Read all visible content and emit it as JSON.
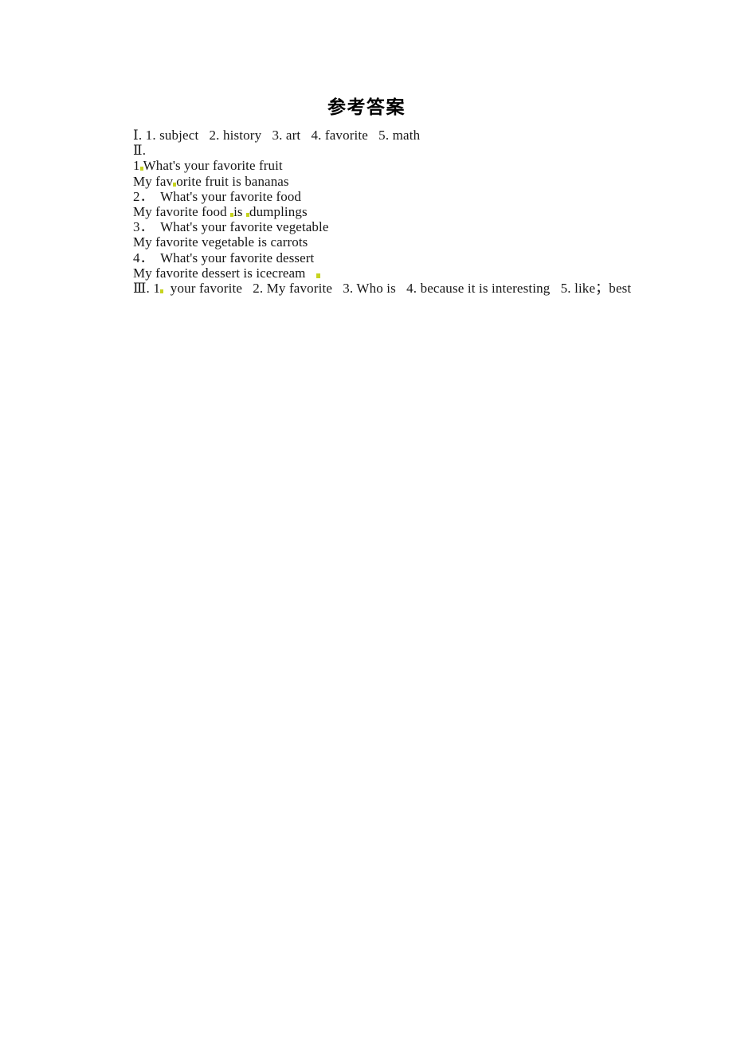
{
  "document": {
    "title": "参考答案",
    "background_color": "#ffffff",
    "text_color": "#161616",
    "artifact_color": "#c8d422"
  },
  "sections": [
    {
      "id": "section-1",
      "marker": "Ⅰ",
      "line": "Ⅰ. 1. subject   2. history   3. art   4. favorite   5. math",
      "answers": [
        {
          "number": "1.",
          "text": "subject"
        },
        {
          "number": "2.",
          "text": "history"
        },
        {
          "number": "3.",
          "text": "art"
        },
        {
          "number": "4.",
          "text": "favorite"
        },
        {
          "number": "5.",
          "text": "math"
        }
      ]
    },
    {
      "id": "section-2",
      "marker": "Ⅱ",
      "line": "Ⅱ.",
      "items": [
        {
          "number": "1．",
          "question": "What's your favorite fruit",
          "answer": "My favorite fruit is bananas"
        },
        {
          "number": "2．",
          "question": "What's your favorite food",
          "answer": "My favorite food  is  dumplings"
        },
        {
          "number": "3．",
          "question": "What's your favorite vegetable",
          "answer": "My favorite vegetable is carrots"
        },
        {
          "number": "4．",
          "question": "What's your favorite dessert",
          "answer": "My favorite dessert is icecream"
        }
      ]
    },
    {
      "id": "section-3",
      "marker": "Ⅲ",
      "line": "Ⅲ. 1.  your favorite   2. My favorite   3. Who is   4. because it is interesting   5. like；best",
      "answers": [
        {
          "number": "1.",
          "text": "your favorite"
        },
        {
          "number": "2.",
          "text": "My favorite"
        },
        {
          "number": "3.",
          "text": "Who is"
        },
        {
          "number": "4.",
          "text": "because it is interesting"
        },
        {
          "number": "5.",
          "text": "like；best"
        }
      ]
    }
  ],
  "lines": {
    "l01": "Ⅰ. 1. subject   2. history   3. art   4. favorite   5. math",
    "l02": "Ⅱ.",
    "l03_a": "1",
    "l03_b": "What's your favorite fruit",
    "l04_a": "My fav",
    "l04_b": "orite fruit is bananas",
    "l05": "2．  What's your favorite food",
    "l06_a": "My favorite food ",
    "l06_b": "is ",
    "l06_c": "dumplings",
    "l07": "3．  What's your favorite vegetable",
    "l08": "My favorite vegetable is carrots",
    "l09": "4．  What's your favorite dessert",
    "l10": "My favorite dessert is icecream",
    "l11_a": "Ⅲ. 1",
    "l11_b": "  your favorite   2. My favorite   3. Who is   4. because it is interesting   5. like；best"
  }
}
